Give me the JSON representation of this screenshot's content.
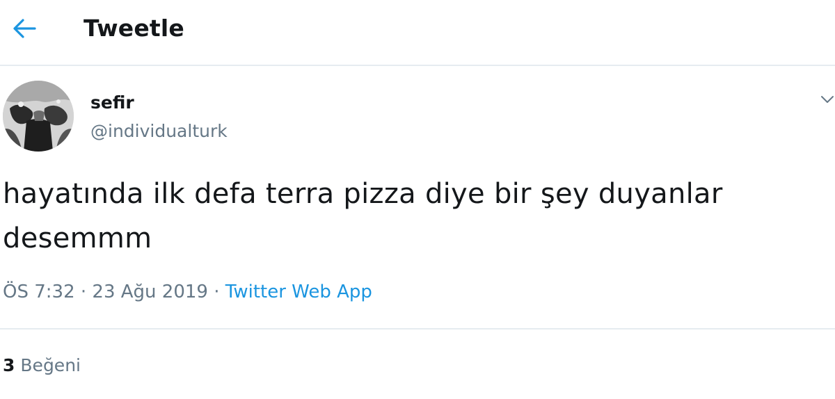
{
  "header": {
    "title": "Tweetle",
    "back_icon": "arrow-left-icon"
  },
  "colors": {
    "accent": "#1b95e0",
    "text": "#14171a",
    "secondary": "#657786",
    "border": "#e6ecf0"
  },
  "tweet": {
    "author": {
      "name": "sefir",
      "handle": "@individualturk",
      "avatar_icon": "avatar"
    },
    "more_icon": "chevron-down-icon",
    "text_lines": [
      "hayatında ilk defa terra pizza diye bir şey duyanlar",
      "desemmm"
    ],
    "time": "ÖS 7:32",
    "separator": "·",
    "date": "23 Ağu 2019",
    "source": "Twitter Web App"
  },
  "stats": {
    "likes_count": "3",
    "likes_label": "Beğeni"
  }
}
